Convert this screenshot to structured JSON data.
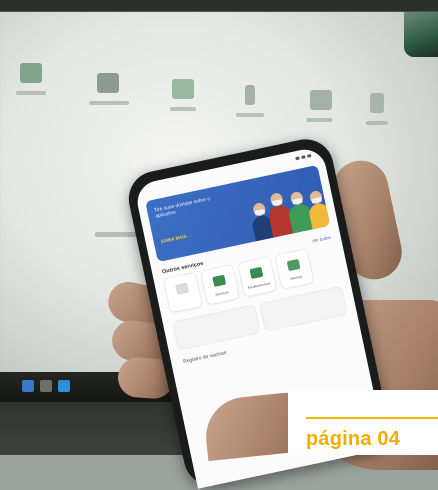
{
  "phone_app": {
    "banner": {
      "title": "Tire suas dúvidas sobre o aplicativo",
      "cta": "SAIBA MAIS →"
    },
    "section": {
      "title": "Outros serviços",
      "link": "Ver todos"
    },
    "services": [
      {
        "label": "",
        "icon": "document-icon"
      },
      {
        "label": "Serviços",
        "icon": "grid-icon"
      },
      {
        "label": "Medicamentos",
        "icon": "pill-icon"
      },
      {
        "label": "Vacinas",
        "icon": "vaccine-icon"
      }
    ],
    "bottom_text": "Registro de vacinas"
  },
  "page_badge": {
    "label": "página 04"
  },
  "colors": {
    "badge_accent": "#f2ae00",
    "banner_blue": "#3e6fc4",
    "service_green": "#3a8a52"
  }
}
